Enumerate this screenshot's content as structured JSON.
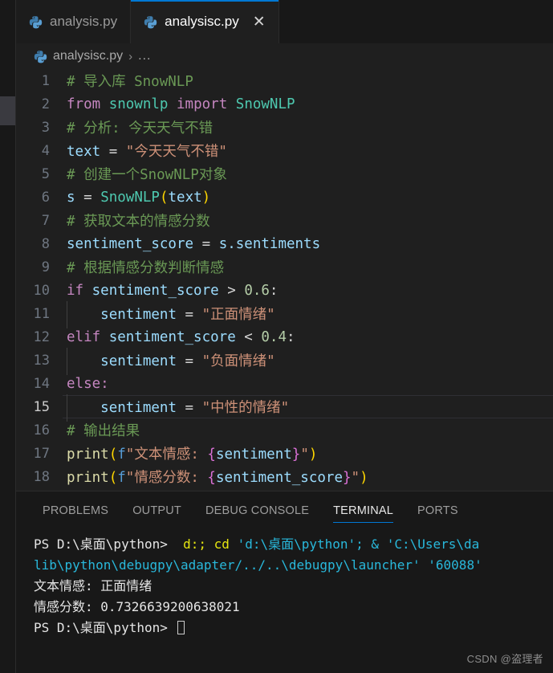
{
  "window": {
    "theme": "vscode-dark",
    "colors": {
      "background": "#1f1f1f",
      "tabbar_bg": "#181818",
      "accent": "#0078d4",
      "comment": "#6a9955",
      "keyword": "#c586c0",
      "string": "#ce9178",
      "variable": "#9cdcfe",
      "class": "#4ec9b0",
      "number": "#b5cea8",
      "function": "#dcdcaa",
      "terminal_cyan": "#29b8db",
      "terminal_yellow": "#e5e510"
    }
  },
  "tabs": [
    {
      "label": "analysis.py",
      "icon": "python-icon",
      "active": false,
      "closable": false
    },
    {
      "label": "analysisc.py",
      "icon": "python-icon",
      "active": true,
      "closable": true,
      "close_glyph": "✕"
    }
  ],
  "breadcrumb": {
    "icon": "python-icon",
    "file": "analysisc.py",
    "separator": "›",
    "dots": "..."
  },
  "editor": {
    "active_line": 15,
    "lines": [
      {
        "n": "1"
      },
      {
        "n": "2"
      },
      {
        "n": "3"
      },
      {
        "n": "4"
      },
      {
        "n": "5"
      },
      {
        "n": "6"
      },
      {
        "n": "7"
      },
      {
        "n": "8"
      },
      {
        "n": "9"
      },
      {
        "n": "10"
      },
      {
        "n": "11"
      },
      {
        "n": "12"
      },
      {
        "n": "13"
      },
      {
        "n": "14"
      },
      {
        "n": "15"
      },
      {
        "n": "16"
      },
      {
        "n": "17"
      },
      {
        "n": "18"
      }
    ],
    "tokens": {
      "l1_comment": "# 导入库 SnowNLP",
      "l2_from": "from",
      "l2_module": "snownlp",
      "l2_import": "import",
      "l2_class": "SnowNLP",
      "l3_comment": "# 分析: 今天天气不错",
      "l4_var": "text",
      "l4_eq": "=",
      "l4_string": "\"今天天气不错\"",
      "l5_comment": "# 创建一个SnowNLP对象",
      "l6_var": "s",
      "l6_eq": "=",
      "l6_class": "SnowNLP",
      "l6_open": "(",
      "l6_arg": "text",
      "l6_close": ")",
      "l7_comment": "# 获取文本的情感分数",
      "l8_var": "sentiment_score",
      "l8_eq": "=",
      "l8_obj": "s.sentiments",
      "l9_comment": "# 根据情感分数判断情感",
      "l10_if": "if",
      "l10_var": "sentiment_score",
      "l10_op": ">",
      "l10_num": "0.6",
      "l10_colon": ":",
      "l11_var": "sentiment",
      "l11_eq": "=",
      "l11_string": "\"正面情绪\"",
      "l12_elif": "elif",
      "l12_var": "sentiment_score",
      "l12_op": "<",
      "l12_num": "0.4",
      "l12_colon": ":",
      "l13_var": "sentiment",
      "l13_eq": "=",
      "l13_string": "\"负面情绪\"",
      "l14_else": "else:",
      "l15_var": "sentiment",
      "l15_eq": "=",
      "l15_string": "\"中性的情绪\"",
      "l16_comment": "# 输出结果",
      "l17_print": "print",
      "l17_open": "(",
      "l17_f": "f",
      "l17_q1": "\"文本情感: ",
      "l17_brace1": "{",
      "l17_expr": "sentiment",
      "l17_brace2": "}",
      "l17_q2": "\"",
      "l17_close": ")",
      "l18_print": "print",
      "l18_open": "(",
      "l18_f": "f",
      "l18_q1": "\"情感分数: ",
      "l18_brace1": "{",
      "l18_expr": "sentiment_score",
      "l18_brace2": "}",
      "l18_q2": "\"",
      "l18_close": ")"
    }
  },
  "panel": {
    "tabs": [
      {
        "label": "PROBLEMS",
        "active": false
      },
      {
        "label": "OUTPUT",
        "active": false
      },
      {
        "label": "DEBUG CONSOLE",
        "active": false
      },
      {
        "label": "TERMINAL",
        "active": true
      },
      {
        "label": "PORTS",
        "active": false
      }
    ],
    "terminal": {
      "line1_prompt": "PS D:\\桌面\\python> ",
      "line1_cmd1": " d:;",
      "line1_cmd2": " cd",
      "line1_cmd3": " 'd:\\桌面\\python'; & 'C:\\Users\\da",
      "line2": "lib\\python\\debugpy\\adapter/../..\\debugpy\\launcher' '60088'",
      "line3": "文本情感: 正面情绪",
      "line4": "情感分数: 0.7326639200638021",
      "line5_prompt": "PS D:\\桌面\\python> "
    }
  },
  "watermark": "CSDN @盗理者"
}
